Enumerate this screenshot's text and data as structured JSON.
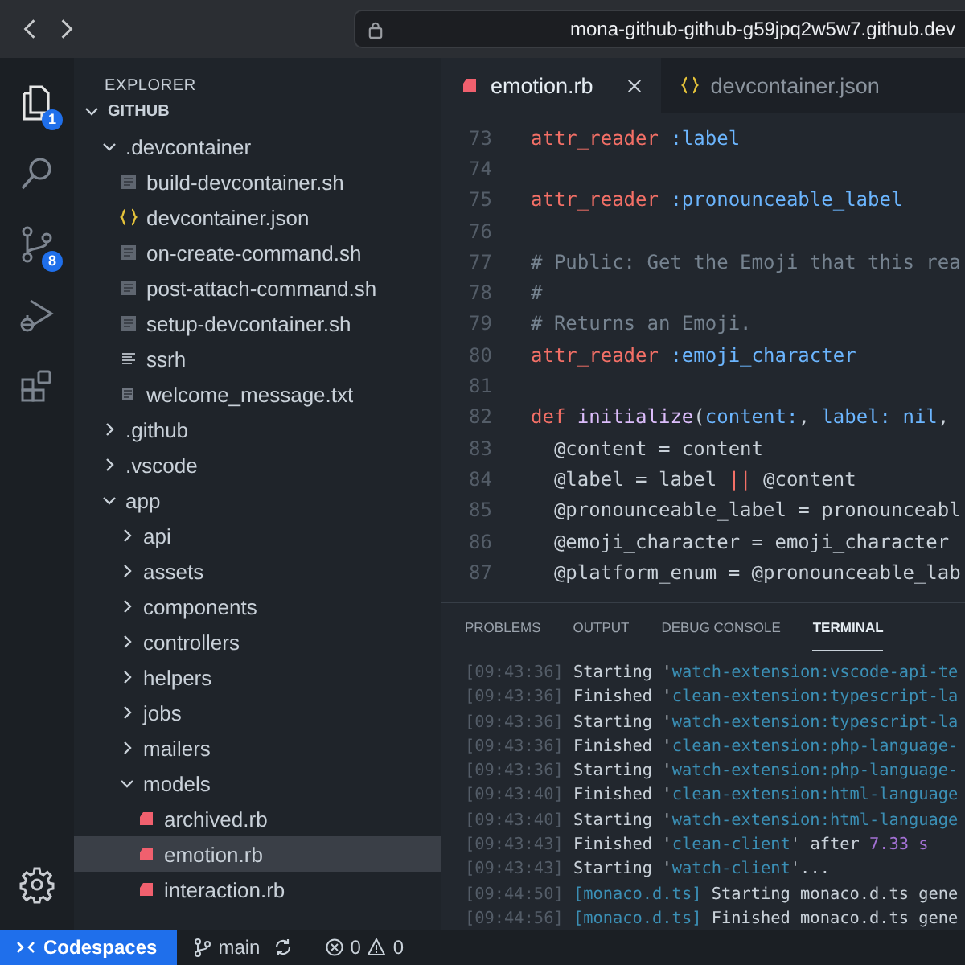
{
  "browser": {
    "url": "mona-github-github-g59jpq2w5w7.github.dev"
  },
  "activity_bar": {
    "items": [
      {
        "kind": "files",
        "badge": "1",
        "selected": true
      },
      {
        "kind": "search",
        "selected": false
      },
      {
        "kind": "source-control",
        "badge": "8",
        "selected": false
      },
      {
        "kind": "run-debug",
        "selected": false
      },
      {
        "kind": "extensions",
        "selected": false
      }
    ],
    "settings": {
      "kind": "gear"
    }
  },
  "sidebar": {
    "title": "EXPLORER",
    "tree": [
      {
        "name": "GITHUB",
        "kind": "folder",
        "expanded": true,
        "selected": false,
        "children": [
          {
            "name": ".devcontainer",
            "kind": "folder",
            "expanded": true,
            "selected": false,
            "children": [
              {
                "name": "build-devcontainer.sh",
                "kind": "shell",
                "selected": false
              },
              {
                "name": "devcontainer.json",
                "kind": "json",
                "selected": false
              },
              {
                "name": "on-create-command.sh",
                "kind": "shell",
                "selected": false
              },
              {
                "name": "post-attach-command.sh",
                "kind": "shell",
                "selected": false
              },
              {
                "name": "setup-devcontainer.sh",
                "kind": "shell",
                "selected": false
              },
              {
                "name": "ssrh",
                "kind": "lines",
                "selected": false
              },
              {
                "name": "welcome_message.txt",
                "kind": "text",
                "selected": false
              }
            ]
          },
          {
            "name": ".github",
            "kind": "folder",
            "expanded": false,
            "selected": false
          },
          {
            "name": ".vscode",
            "kind": "folder",
            "expanded": false,
            "selected": false
          },
          {
            "name": "app",
            "kind": "folder",
            "expanded": true,
            "selected": false,
            "children": [
              {
                "name": "api",
                "kind": "folder",
                "expanded": false,
                "selected": false
              },
              {
                "name": "assets",
                "kind": "folder",
                "expanded": false,
                "selected": false
              },
              {
                "name": "components",
                "kind": "folder",
                "expanded": false,
                "selected": false
              },
              {
                "name": "controllers",
                "kind": "folder",
                "expanded": false,
                "selected": false
              },
              {
                "name": "helpers",
                "kind": "folder",
                "expanded": false,
                "selected": false
              },
              {
                "name": "jobs",
                "kind": "folder",
                "expanded": false,
                "selected": false
              },
              {
                "name": "mailers",
                "kind": "folder",
                "expanded": false,
                "selected": false
              },
              {
                "name": "models",
                "kind": "folder",
                "expanded": true,
                "selected": false,
                "children": [
                  {
                    "name": "archived.rb",
                    "kind": "ruby",
                    "selected": false
                  },
                  {
                    "name": "emotion.rb",
                    "kind": "ruby",
                    "selected": true
                  },
                  {
                    "name": "interaction.rb",
                    "kind": "ruby",
                    "selected": false
                  }
                ]
              }
            ]
          }
        ]
      }
    ]
  },
  "editor": {
    "tabs": [
      {
        "label": "emotion.rb",
        "kind": "ruby",
        "selected": true,
        "closable": true
      },
      {
        "label": "devcontainer.json",
        "kind": "json",
        "selected": false,
        "closable": false
      }
    ],
    "lines": [
      {
        "number": "73",
        "tokens": [
          {
            "t": "attr_reader",
            "kind": "keyword"
          },
          {
            "t": " :label",
            "kind": "symbol"
          }
        ]
      },
      {
        "number": "74"
      },
      {
        "number": "75",
        "tokens": [
          {
            "t": "attr_reader",
            "kind": "keyword"
          },
          {
            "t": " :pronounceable_label",
            "kind": "symbol"
          }
        ]
      },
      {
        "number": "76"
      },
      {
        "number": "77",
        "tokens": [
          {
            "t": "# Public: Get the Emoji that this rea",
            "kind": "comment"
          }
        ]
      },
      {
        "number": "78",
        "tokens": [
          {
            "t": "#",
            "kind": "comment"
          }
        ]
      },
      {
        "number": "79",
        "tokens": [
          {
            "t": "# Returns an Emoji.",
            "kind": "comment"
          }
        ]
      },
      {
        "number": "80",
        "tokens": [
          {
            "t": "attr_reader",
            "kind": "keyword"
          },
          {
            "t": " :emoji_character",
            "kind": "symbol"
          }
        ]
      },
      {
        "number": "81"
      },
      {
        "number": "82",
        "tokens": [
          {
            "t": "def",
            "kind": "keyword"
          },
          {
            "t": " initialize",
            "kind": "function"
          },
          {
            "t": "("
          },
          {
            "t": "content:",
            "kind": "symbol"
          },
          {
            "t": ", "
          },
          {
            "t": "label: nil",
            "kind": "symbol"
          },
          {
            "t": ","
          }
        ]
      },
      {
        "number": "83",
        "tokens": [
          {
            "t": "  @content = content"
          }
        ]
      },
      {
        "number": "84",
        "tokens": [
          {
            "t": "  @label = label "
          },
          {
            "t": "||",
            "kind": "keyword"
          },
          {
            "t": " @content"
          }
        ]
      },
      {
        "number": "85",
        "tokens": [
          {
            "t": "  @pronounceable_label = pronounceabl"
          }
        ]
      },
      {
        "number": "86",
        "tokens": [
          {
            "t": "  @emoji_character = emoji_character"
          }
        ]
      },
      {
        "number": "87",
        "tokens": [
          {
            "t": "  @platform_enum = @pronounceable_lab"
          }
        ]
      }
    ]
  },
  "panel": {
    "tabs": [
      {
        "label": "PROBLEMS",
        "selected": false
      },
      {
        "label": "OUTPUT",
        "selected": false
      },
      {
        "label": "DEBUG CONSOLE",
        "selected": false
      },
      {
        "label": "TERMINAL",
        "selected": true
      }
    ],
    "terminal": [
      {
        "time": "[09:43:36]",
        "tokens": [
          {
            "t": " Starting '"
          },
          {
            "t": "watch-extension:vscode-api-te",
            "kind": "string"
          }
        ]
      },
      {
        "time": "[09:43:36]",
        "tokens": [
          {
            "t": " Finished '"
          },
          {
            "t": "clean-extension:typescript-la",
            "kind": "string"
          }
        ]
      },
      {
        "time": "[09:43:36]",
        "tokens": [
          {
            "t": " Starting '"
          },
          {
            "t": "watch-extension:typescript-la",
            "kind": "string"
          }
        ]
      },
      {
        "time": "[09:43:36]",
        "tokens": [
          {
            "t": " Finished '"
          },
          {
            "t": "clean-extension:php-language-",
            "kind": "string"
          }
        ]
      },
      {
        "time": "[09:43:36]",
        "tokens": [
          {
            "t": " Starting '"
          },
          {
            "t": "watch-extension:php-language-",
            "kind": "string"
          }
        ]
      },
      {
        "time": "[09:43:40]",
        "tokens": [
          {
            "t": " Finished '"
          },
          {
            "t": "clean-extension:html-language",
            "kind": "string"
          }
        ]
      },
      {
        "time": "[09:43:40]",
        "tokens": [
          {
            "t": " Starting '"
          },
          {
            "t": "watch-extension:html-language",
            "kind": "string"
          }
        ]
      },
      {
        "time": "[09:43:43]",
        "tokens": [
          {
            "t": " Finished '"
          },
          {
            "t": "clean-client",
            "kind": "string"
          },
          {
            "t": "' after "
          },
          {
            "t": "7.33 s",
            "kind": "number"
          }
        ]
      },
      {
        "time": "[09:43:43]",
        "tokens": [
          {
            "t": " Starting '"
          },
          {
            "t": "watch-client",
            "kind": "string"
          },
          {
            "t": "'..."
          }
        ]
      },
      {
        "time": "[09:44:50]",
        "tokens": [
          {
            "t": " [monaco.d.ts]",
            "kind": "string"
          },
          {
            "t": " Starting monaco.d.ts gene"
          }
        ]
      },
      {
        "time": "[09:44:56]",
        "tokens": [
          {
            "t": " [monaco.d.ts]",
            "kind": "string"
          },
          {
            "t": " Finished monaco.d.ts gene"
          }
        ]
      }
    ]
  },
  "status_bar": {
    "remote": "Codespaces",
    "branch": "main",
    "errors": "0",
    "warnings": "0"
  }
}
